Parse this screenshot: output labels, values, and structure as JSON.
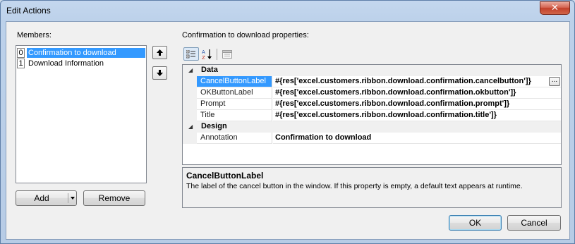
{
  "window": {
    "title": "Edit Actions",
    "close_glyph": "✕"
  },
  "members": {
    "label": "Members:",
    "items": [
      {
        "index": "0",
        "label": "Confirmation to download",
        "selected": true
      },
      {
        "index": "1",
        "label": "Download Information",
        "selected": false
      }
    ],
    "move_up_icon": "arrow-up-icon",
    "move_down_icon": "arrow-down-icon",
    "add_label": "Add",
    "remove_label": "Remove"
  },
  "properties": {
    "heading": "Confirmation to download properties:",
    "toolbar": [
      "categorized-icon",
      "alphabetical-icon",
      "property-pages-icon"
    ],
    "categories": [
      {
        "name": "Data",
        "rows": [
          {
            "name": "CancelButtonLabel",
            "value": "#{res['excel.customers.ribbon.download.confirmation.cancelbutton']}",
            "selected": true
          },
          {
            "name": "OKButtonLabel",
            "value": "#{res['excel.customers.ribbon.download.confirmation.okbutton']}",
            "selected": false
          },
          {
            "name": "Prompt",
            "value": "#{res['excel.customers.ribbon.download.confirmation.prompt']}",
            "selected": false
          },
          {
            "name": "Title",
            "value": "#{res['excel.customers.ribbon.download.confirmation.title']}",
            "selected": false
          }
        ]
      },
      {
        "name": "Design",
        "rows": [
          {
            "name": "Annotation",
            "value": "Confirmation to download",
            "selected": false
          }
        ]
      }
    ],
    "ellipsis_label": "...",
    "help": {
      "title": "CancelButtonLabel",
      "description": "The label of the cancel button in the window. If this property is empty, a default text appears at runtime."
    }
  },
  "footer": {
    "ok_label": "OK",
    "cancel_label": "Cancel"
  }
}
